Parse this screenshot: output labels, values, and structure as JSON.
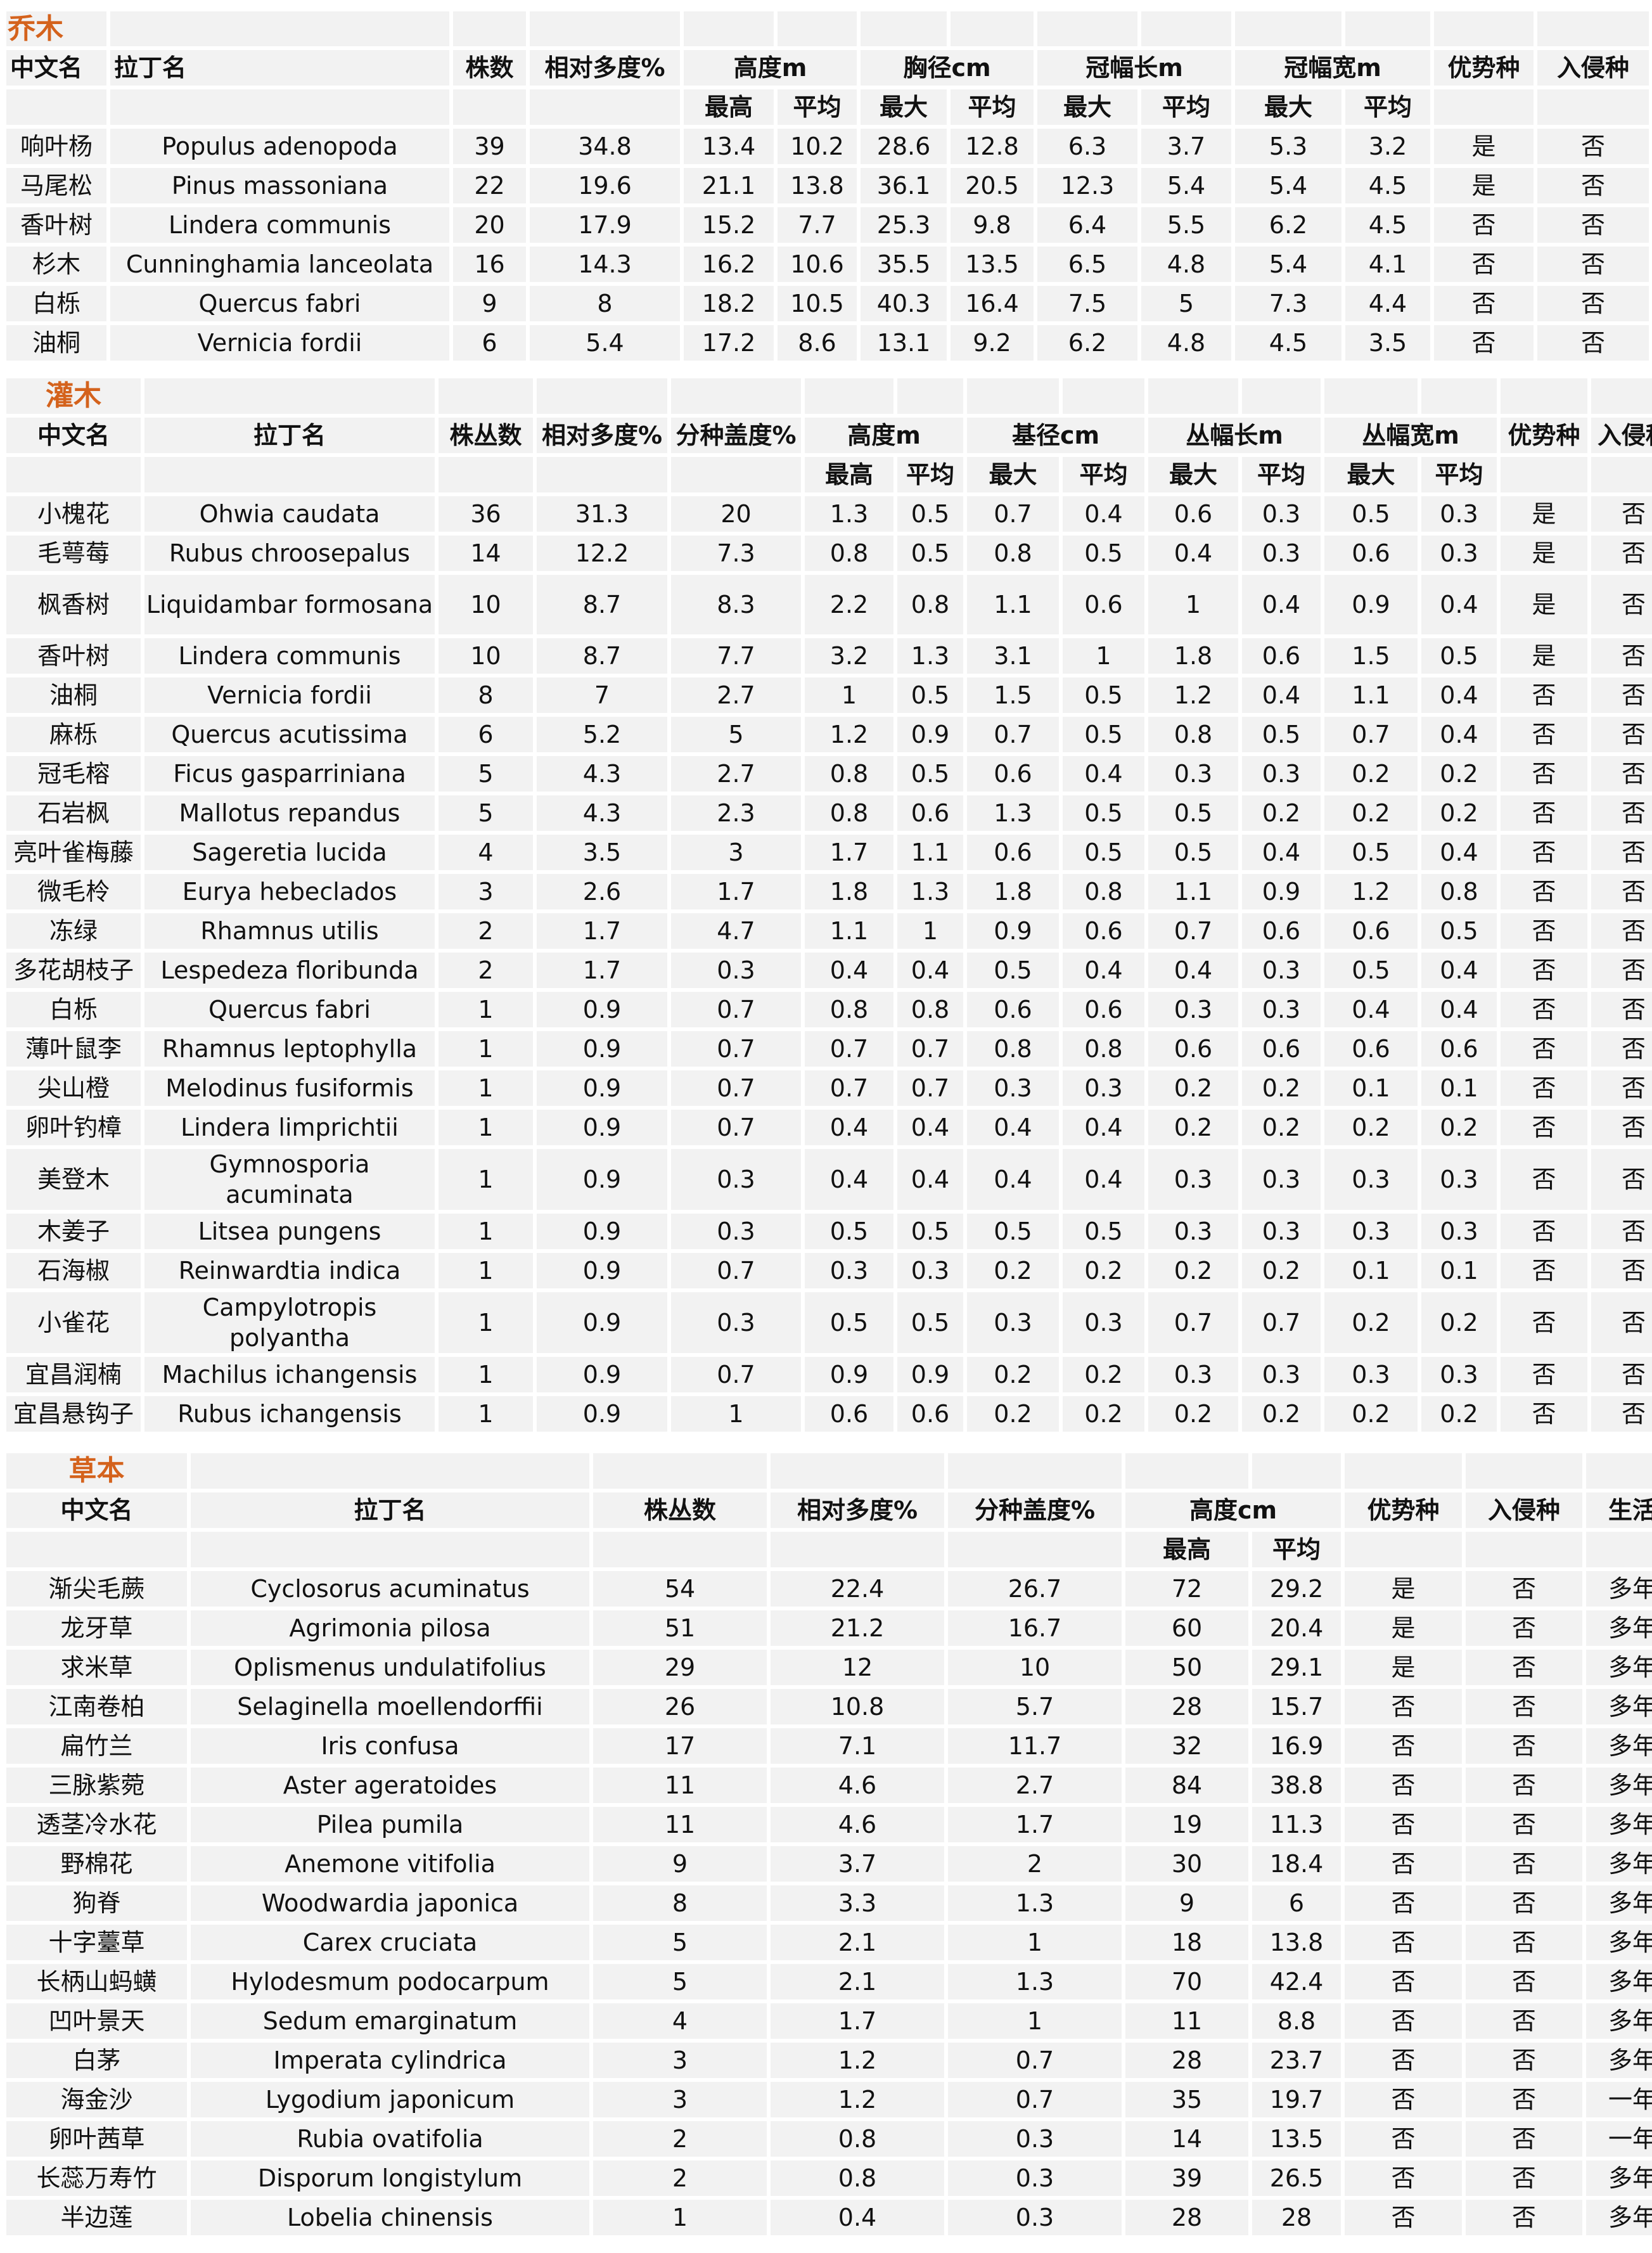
{
  "colors": {
    "section_title": "#d4621c",
    "cell_bg": "#f2f2f2",
    "grid": "#ffffff"
  },
  "trees": {
    "title": "乔木",
    "headers": [
      "中文名",
      "拉丁名",
      "株数",
      "相对多度%",
      "高度m",
      "胸径cm",
      "冠幅长m",
      "冠幅宽m",
      "优势种",
      "入侵种"
    ],
    "subheaders": [
      "最高",
      "平均",
      "最大",
      "平均",
      "最大",
      "平均",
      "最大",
      "平均"
    ],
    "rows": [
      [
        "响叶杨",
        "Populus adenopoda",
        "39",
        "34.8",
        "13.4",
        "10.2",
        "28.6",
        "12.8",
        "6.3",
        "3.7",
        "5.3",
        "3.2",
        "是",
        "否"
      ],
      [
        "马尾松",
        "Pinus massoniana",
        "22",
        "19.6",
        "21.1",
        "13.8",
        "36.1",
        "20.5",
        "12.3",
        "5.4",
        "5.4",
        "4.5",
        "是",
        "否"
      ],
      [
        "香叶树",
        "Lindera communis",
        "20",
        "17.9",
        "15.2",
        "7.7",
        "25.3",
        "9.8",
        "6.4",
        "5.5",
        "6.2",
        "4.5",
        "否",
        "否"
      ],
      [
        "杉木",
        "Cunninghamia lanceolata",
        "16",
        "14.3",
        "16.2",
        "10.6",
        "35.5",
        "13.5",
        "6.5",
        "4.8",
        "5.4",
        "4.1",
        "否",
        "否"
      ],
      [
        "白栎",
        "Quercus fabri",
        "9",
        "8",
        "18.2",
        "10.5",
        "40.3",
        "16.4",
        "7.5",
        "5",
        "7.3",
        "4.4",
        "否",
        "否"
      ],
      [
        "油桐",
        "Vernicia fordii",
        "6",
        "5.4",
        "17.2",
        "8.6",
        "13.1",
        "9.2",
        "6.2",
        "4.8",
        "4.5",
        "3.5",
        "否",
        "否"
      ]
    ]
  },
  "shrubs": {
    "title": "灌木",
    "headers": [
      "中文名",
      "拉丁名",
      "株丛数",
      "相对多度%",
      "分种盖度%",
      "高度m",
      "基径cm",
      "丛幅长m",
      "丛幅宽m",
      "优势种",
      "入侵种"
    ],
    "subheaders": [
      "最高",
      "平均",
      "最大",
      "平均",
      "最大",
      "平均",
      "最大",
      "平均"
    ],
    "rows": [
      [
        "小槐花",
        "Ohwia caudata",
        "36",
        "31.3",
        "20",
        "1.3",
        "0.5",
        "0.7",
        "0.4",
        "0.6",
        "0.3",
        "0.5",
        "0.3",
        "是",
        "否"
      ],
      [
        "毛萼莓",
        "Rubus chroosepalus",
        "14",
        "12.2",
        "7.3",
        "0.8",
        "0.5",
        "0.8",
        "0.5",
        "0.4",
        "0.3",
        "0.6",
        "0.3",
        "是",
        "否"
      ],
      [
        "枫香树",
        "Liquidambar formosana",
        "10",
        "8.7",
        "8.3",
        "2.2",
        "0.8",
        "1.1",
        "0.6",
        "1",
        "0.4",
        "0.9",
        "0.4",
        "是",
        "否"
      ],
      [
        "香叶树",
        "Lindera communis",
        "10",
        "8.7",
        "7.7",
        "3.2",
        "1.3",
        "3.1",
        "1",
        "1.8",
        "0.6",
        "1.5",
        "0.5",
        "是",
        "否"
      ],
      [
        "油桐",
        "Vernicia fordii",
        "8",
        "7",
        "2.7",
        "1",
        "0.5",
        "1.5",
        "0.5",
        "1.2",
        "0.4",
        "1.1",
        "0.4",
        "否",
        "否"
      ],
      [
        "麻栎",
        "Quercus acutissima",
        "6",
        "5.2",
        "5",
        "1.2",
        "0.9",
        "0.7",
        "0.5",
        "0.8",
        "0.5",
        "0.7",
        "0.4",
        "否",
        "否"
      ],
      [
        "冠毛榕",
        "Ficus gasparriniana",
        "5",
        "4.3",
        "2.7",
        "0.8",
        "0.5",
        "0.6",
        "0.4",
        "0.3",
        "0.3",
        "0.2",
        "0.2",
        "否",
        "否"
      ],
      [
        "石岩枫",
        "Mallotus repandus",
        "5",
        "4.3",
        "2.3",
        "0.8",
        "0.6",
        "1.3",
        "0.5",
        "0.5",
        "0.2",
        "0.2",
        "0.2",
        "否",
        "否"
      ],
      [
        "亮叶雀梅藤",
        "Sageretia lucida",
        "4",
        "3.5",
        "3",
        "1.7",
        "1.1",
        "0.6",
        "0.5",
        "0.5",
        "0.4",
        "0.5",
        "0.4",
        "否",
        "否"
      ],
      [
        "微毛柃",
        "Eurya hebeclados",
        "3",
        "2.6",
        "1.7",
        "1.8",
        "1.3",
        "1.8",
        "0.8",
        "1.1",
        "0.9",
        "1.2",
        "0.8",
        "否",
        "否"
      ],
      [
        "冻绿",
        "Rhamnus utilis",
        "2",
        "1.7",
        "4.7",
        "1.1",
        "1",
        "0.9",
        "0.6",
        "0.7",
        "0.6",
        "0.6",
        "0.5",
        "否",
        "否"
      ],
      [
        "多花胡枝子",
        "Lespedeza floribunda",
        "2",
        "1.7",
        "0.3",
        "0.4",
        "0.4",
        "0.5",
        "0.4",
        "0.4",
        "0.3",
        "0.5",
        "0.4",
        "否",
        "否"
      ],
      [
        "白栎",
        "Quercus fabri",
        "1",
        "0.9",
        "0.7",
        "0.8",
        "0.8",
        "0.6",
        "0.6",
        "0.3",
        "0.3",
        "0.4",
        "0.4",
        "否",
        "否"
      ],
      [
        "薄叶鼠李",
        "Rhamnus leptophylla",
        "1",
        "0.9",
        "0.7",
        "0.7",
        "0.7",
        "0.8",
        "0.8",
        "0.6",
        "0.6",
        "0.6",
        "0.6",
        "否",
        "否"
      ],
      [
        "尖山橙",
        "Melodinus fusiformis",
        "1",
        "0.9",
        "0.7",
        "0.7",
        "0.7",
        "0.3",
        "0.3",
        "0.2",
        "0.2",
        "0.1",
        "0.1",
        "否",
        "否"
      ],
      [
        "卵叶钓樟",
        "Lindera limprichtii",
        "1",
        "0.9",
        "0.7",
        "0.4",
        "0.4",
        "0.4",
        "0.4",
        "0.2",
        "0.2",
        "0.2",
        "0.2",
        "否",
        "否"
      ],
      [
        "美登木",
        "Gymnosporia acuminata",
        "1",
        "0.9",
        "0.3",
        "0.4",
        "0.4",
        "0.4",
        "0.4",
        "0.3",
        "0.3",
        "0.3",
        "0.3",
        "否",
        "否"
      ],
      [
        "木姜子",
        "Litsea pungens",
        "1",
        "0.9",
        "0.3",
        "0.5",
        "0.5",
        "0.5",
        "0.5",
        "0.3",
        "0.3",
        "0.3",
        "0.3",
        "否",
        "否"
      ],
      [
        "石海椒",
        "Reinwardtia indica",
        "1",
        "0.9",
        "0.7",
        "0.3",
        "0.3",
        "0.2",
        "0.2",
        "0.2",
        "0.2",
        "0.1",
        "0.1",
        "否",
        "否"
      ],
      [
        "小雀花",
        "Campylotropis polyantha",
        "1",
        "0.9",
        "0.3",
        "0.5",
        "0.5",
        "0.3",
        "0.3",
        "0.7",
        "0.7",
        "0.2",
        "0.2",
        "否",
        "否"
      ],
      [
        "宜昌润楠",
        "Machilus ichangensis",
        "1",
        "0.9",
        "0.7",
        "0.9",
        "0.9",
        "0.2",
        "0.2",
        "0.3",
        "0.3",
        "0.3",
        "0.3",
        "否",
        "否"
      ],
      [
        "宜昌悬钩子",
        "Rubus ichangensis",
        "1",
        "0.9",
        "1",
        "0.6",
        "0.6",
        "0.2",
        "0.2",
        "0.2",
        "0.2",
        "0.2",
        "0.2",
        "否",
        "否"
      ]
    ]
  },
  "herbs": {
    "title": "草本",
    "headers": [
      "中文名",
      "拉丁名",
      "株丛数",
      "相对多度%",
      "分种盖度%",
      "高度cm",
      "优势种",
      "入侵种",
      "生活型"
    ],
    "subheaders": [
      "最高",
      "平均"
    ],
    "rows": [
      [
        "渐尖毛蕨",
        "Cyclosorus acuminatus",
        "54",
        "22.4",
        "26.7",
        "72",
        "29.2",
        "是",
        "否",
        "多年生"
      ],
      [
        "龙牙草",
        "Agrimonia pilosa",
        "51",
        "21.2",
        "16.7",
        "60",
        "20.4",
        "是",
        "否",
        "多年生"
      ],
      [
        "求米草",
        "Oplismenus undulatifolius",
        "29",
        "12",
        "10",
        "50",
        "29.1",
        "是",
        "否",
        "多年生"
      ],
      [
        "江南卷柏",
        "Selaginella moellendorffii",
        "26",
        "10.8",
        "5.7",
        "28",
        "15.7",
        "否",
        "否",
        "多年生"
      ],
      [
        "扁竹兰",
        "Iris confusa",
        "17",
        "7.1",
        "11.7",
        "32",
        "16.9",
        "否",
        "否",
        "多年生"
      ],
      [
        "三脉紫菀",
        "Aster ageratoides",
        "11",
        "4.6",
        "2.7",
        "84",
        "38.8",
        "否",
        "否",
        "多年生"
      ],
      [
        "透茎冷水花",
        "Pilea pumila",
        "11",
        "4.6",
        "1.7",
        "19",
        "11.3",
        "否",
        "否",
        "多年生"
      ],
      [
        "野棉花",
        "Anemone vitifolia",
        "9",
        "3.7",
        "2",
        "30",
        "18.4",
        "否",
        "否",
        "多年生"
      ],
      [
        "狗脊",
        "Woodwardia japonica",
        "8",
        "3.3",
        "1.3",
        "9",
        "6",
        "否",
        "否",
        "多年生"
      ],
      [
        "十字薹草",
        "Carex cruciata",
        "5",
        "2.1",
        "1",
        "18",
        "13.8",
        "否",
        "否",
        "多年生"
      ],
      [
        "长柄山蚂蟥",
        "Hylodesmum podocarpum",
        "5",
        "2.1",
        "1.3",
        "70",
        "42.4",
        "否",
        "否",
        "多年生"
      ],
      [
        "凹叶景天",
        "Sedum emarginatum",
        "4",
        "1.7",
        "1",
        "11",
        "8.8",
        "否",
        "否",
        "多年生"
      ],
      [
        "白茅",
        "Imperata cylindrica",
        "3",
        "1.2",
        "0.7",
        "28",
        "23.7",
        "否",
        "否",
        "多年生"
      ],
      [
        "海金沙",
        "Lygodium japonicum",
        "3",
        "1.2",
        "0.7",
        "35",
        "19.7",
        "否",
        "否",
        "一年生"
      ],
      [
        "卵叶茜草",
        "Rubia ovatifolia",
        "2",
        "0.8",
        "0.3",
        "14",
        "13.5",
        "否",
        "否",
        "一年生"
      ],
      [
        "长蕊万寿竹",
        "Disporum longistylum",
        "2",
        "0.8",
        "0.3",
        "39",
        "26.5",
        "否",
        "否",
        "多年生"
      ],
      [
        "半边莲",
        "Lobelia chinensis",
        "1",
        "0.4",
        "0.3",
        "28",
        "28",
        "否",
        "否",
        "多年生"
      ]
    ]
  }
}
